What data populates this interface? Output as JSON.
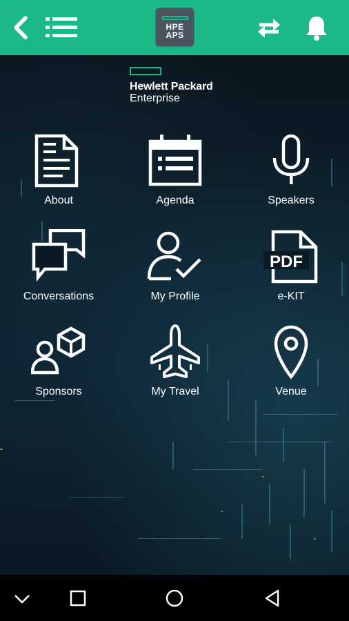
{
  "header": {
    "badge_line1": "HPE",
    "badge_line2": "APS",
    "icons": [
      "back-arrow-icon",
      "hamburger-menu-icon",
      "sync-icon",
      "bell-icon"
    ],
    "accent_color": "#1bb98a"
  },
  "brand": {
    "line1": "Hewlett Packard",
    "line2": "Enterprise"
  },
  "tiles": [
    {
      "label": "About",
      "icon": "document-icon"
    },
    {
      "label": "Agenda",
      "icon": "calendar-icon"
    },
    {
      "label": "Speakers",
      "icon": "microphone-icon"
    },
    {
      "label": "Conversations",
      "icon": "chat-bubbles-icon"
    },
    {
      "label": "My Profile",
      "icon": "profile-check-icon"
    },
    {
      "label": "e-KIT",
      "icon": "pdf-icon"
    },
    {
      "label": "Sponsors",
      "icon": "sponsors-icon"
    },
    {
      "label": "My Travel",
      "icon": "airplane-icon"
    },
    {
      "label": "Venue",
      "icon": "location-pin-icon"
    }
  ],
  "system_nav": {
    "icons": [
      "nav-down-icon",
      "nav-recents-icon",
      "nav-home-icon",
      "nav-back-icon"
    ]
  }
}
